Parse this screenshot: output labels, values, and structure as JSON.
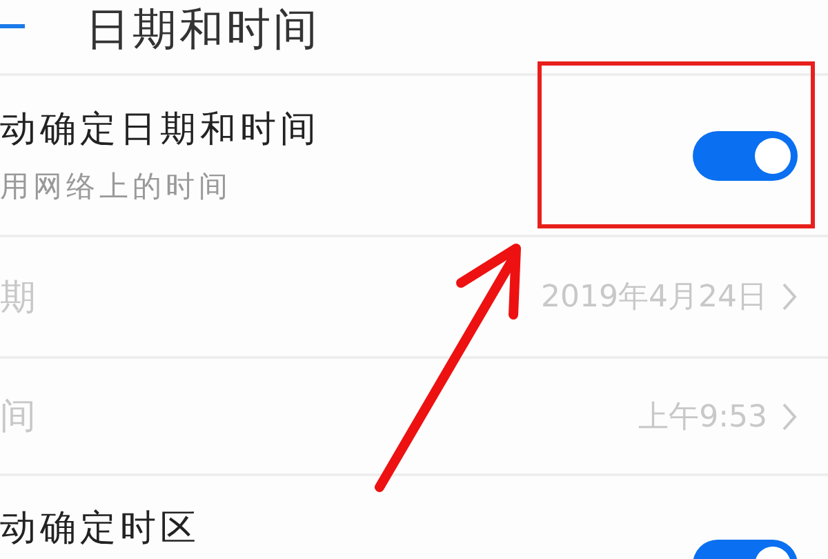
{
  "header": {
    "title": "日期和时间"
  },
  "settings": [
    {
      "kind": "switch",
      "title": "动确定日期和时间",
      "subtitle": "用网络上的时间",
      "on": true
    },
    {
      "kind": "value",
      "title": "期",
      "value": "2019年4月24日",
      "disabled": true
    },
    {
      "kind": "value",
      "title": "间",
      "value": "上午9:53",
      "disabled": true
    },
    {
      "kind": "switch",
      "title": "动确定时区",
      "on": true
    }
  ]
}
